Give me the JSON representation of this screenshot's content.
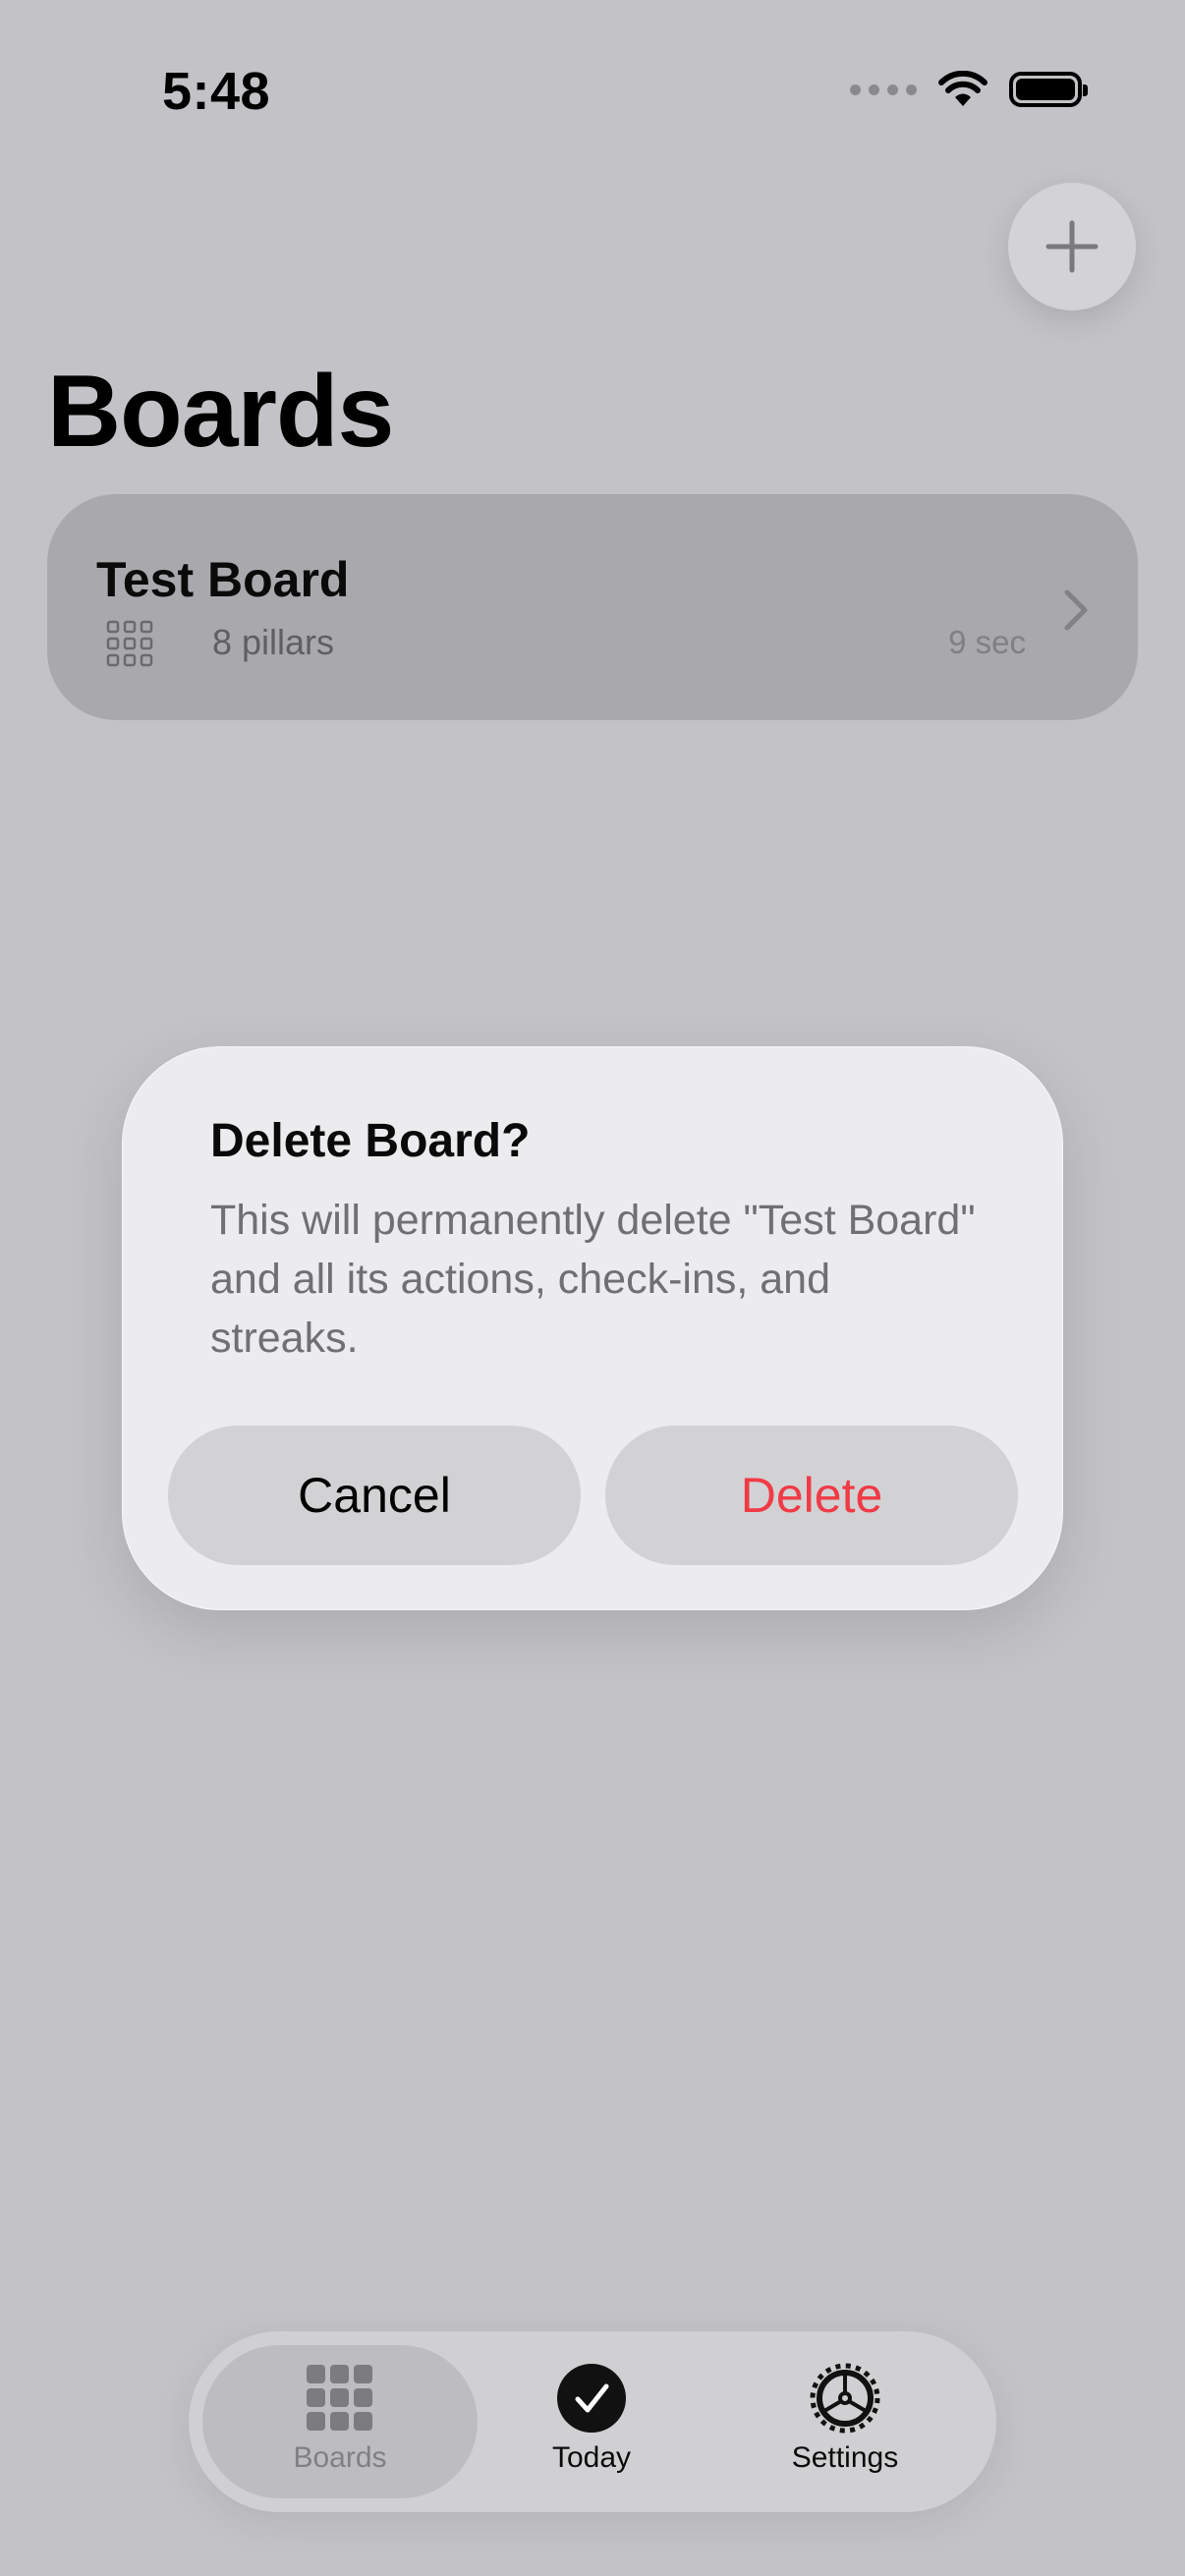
{
  "status_bar": {
    "time": "5:48"
  },
  "header": {
    "title": "Boards",
    "add_icon": "plus-icon"
  },
  "boards": [
    {
      "name": "Test Board",
      "pillars": "8 pillars",
      "elapsed": "9 sec",
      "icon": "grid-icon"
    }
  ],
  "dialog": {
    "title": "Delete Board?",
    "message": "This will permanently delete \"Test Board\" and all its actions, check-ins, and streaks.",
    "cancel_label": "Cancel",
    "delete_label": "Delete"
  },
  "tab_bar": {
    "items": [
      {
        "label": "Boards",
        "icon": "grid-icon",
        "selected": true
      },
      {
        "label": "Today",
        "icon": "checkmark-circle-icon",
        "selected": false
      },
      {
        "label": "Settings",
        "icon": "gear-icon",
        "selected": false
      }
    ]
  },
  "colors": {
    "background": "#c3c3c7",
    "card": "#a9a9ad",
    "dialog": "#ececee",
    "destructive": "#f03a45"
  }
}
